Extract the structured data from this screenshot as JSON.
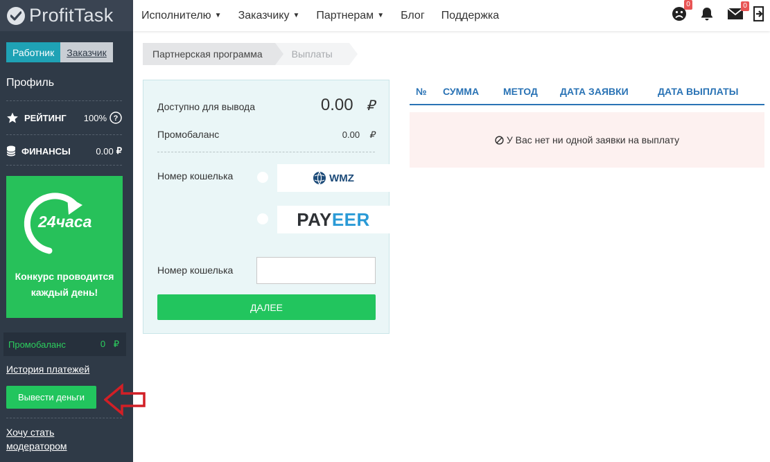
{
  "brand": {
    "name": "ProfitTask"
  },
  "sidebar": {
    "role_active": "Работник",
    "role_other": "Заказчик",
    "profile": "Профиль",
    "rating_label": "РЕЙТИНГ",
    "rating_value": "100%",
    "finance_label": "ФИНАНСЫ",
    "finance_value": "0.00",
    "currency": "₽",
    "banner_hours": "24часа",
    "banner_text": "Конкурс проводится каждый день!",
    "promo_label": "Промобаланс",
    "promo_value": "0",
    "history_link": "История платежей",
    "withdraw_button": "Вывести деньги",
    "moderator_link": "Хочу стать модератором"
  },
  "topnav": {
    "items": [
      "Исполнителю",
      "Заказчику",
      "Партнерам",
      "Блог",
      "Поддержка"
    ],
    "complaints_badge": "0",
    "messages_badge": "0"
  },
  "breadcrumb": {
    "items": [
      "Партнерская программа",
      "Выплаты"
    ]
  },
  "withdraw": {
    "available_label": "Доступно для вывода",
    "available_value": "0.00",
    "promo_label": "Промобаланс",
    "promo_value": "0.00",
    "currency": "₽",
    "wallet_label_1": "Номер кошелька",
    "method_1": "WMZ",
    "method_2_a": "PAY",
    "method_2_b": "EER",
    "wallet_label_2": "Номер кошелька",
    "wallet_value": "",
    "next_button": "ДАЛЕЕ"
  },
  "payouts_table": {
    "columns": [
      "№",
      "СУММА",
      "МЕТОД",
      "ДАТА ЗАЯВКИ",
      "ДАТА ВЫПЛАТЫ"
    ],
    "empty_message": "У Вас нет ни одной заявки на выплату"
  },
  "colors": {
    "sidebar_bg": "#2f3a47",
    "accent_green": "#22c55e",
    "accent_teal": "#1fa2b5",
    "table_blue": "#2a73b5",
    "annotation_red": "#d21f26"
  }
}
